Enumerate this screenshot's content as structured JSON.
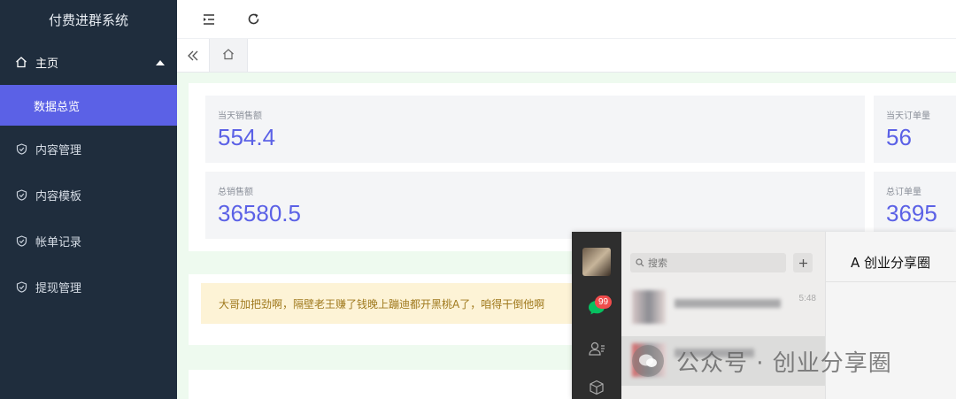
{
  "sidebar": {
    "brand": "付费进群系统",
    "main_label": "主页",
    "submenu_label": "数据总览",
    "items": [
      {
        "label": "内容管理"
      },
      {
        "label": "内容模板"
      },
      {
        "label": "帐单记录"
      },
      {
        "label": "提现管理"
      }
    ]
  },
  "stats": {
    "today_sales_label": "当天销售额",
    "today_sales_value": "554.4",
    "today_orders_label": "当天订单量",
    "today_orders_value": "56",
    "total_sales_label": "总销售额",
    "total_sales_value": "36580.5",
    "total_orders_label": "总订单量",
    "total_orders_value": "3695"
  },
  "notice": "大哥加把劲啊，隔壁老王赚了钱晚上蹦迪都开黑桃A了，咱得干倒他啊",
  "wechat": {
    "badge": "99",
    "search_placeholder": "搜索",
    "time": "5:48",
    "chat_title": "A 创业分享圈",
    "watermark": "公众号 · 创业分享圈"
  },
  "colors": {
    "sidebar_bg": "#1f2d3d",
    "accent": "#5b61e6",
    "notice_bg": "#fdf3d6"
  }
}
